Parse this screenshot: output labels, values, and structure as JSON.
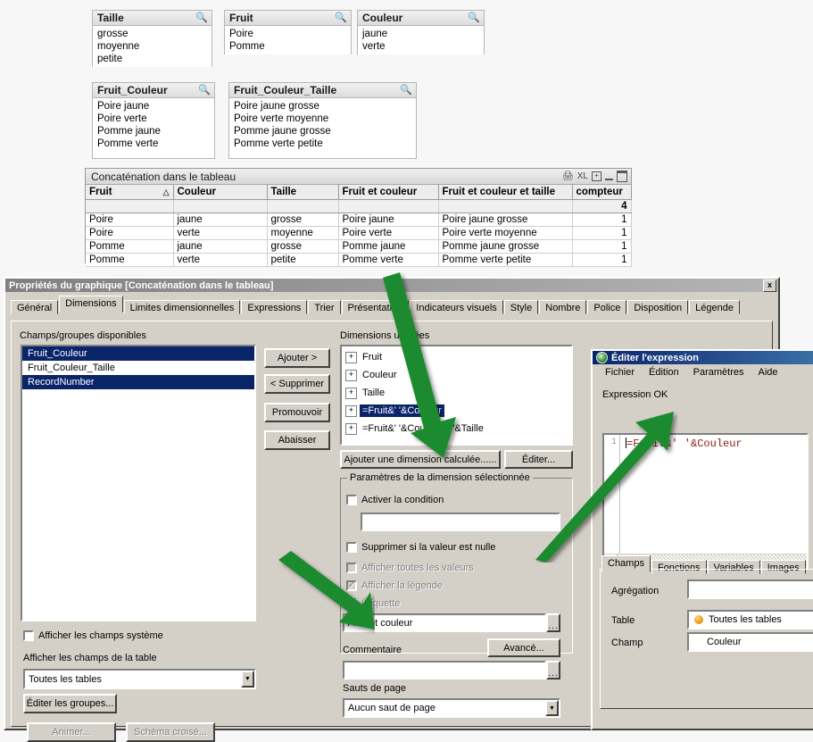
{
  "listboxes": [
    {
      "title": "Taille",
      "icon": "magnifier-icon",
      "values": [
        "grosse",
        "moyenne",
        "petite"
      ]
    },
    {
      "title": "Fruit",
      "icon": "magnifier-icon",
      "values": [
        "Poire",
        "Pomme"
      ]
    },
    {
      "title": "Couleur",
      "icon": "magnifier-icon",
      "values": [
        "jaune",
        "verte"
      ]
    },
    {
      "title": "Fruit_Couleur",
      "icon": "magnifier-icon",
      "values": [
        "Poire jaune",
        "Poire verte",
        "Pomme jaune",
        "Pomme verte"
      ]
    },
    {
      "title": "Fruit_Couleur_Taille",
      "icon": "magnifier-icon",
      "values": [
        "Poire jaune grosse",
        "Poire verte moyenne",
        "Pomme jaune grosse",
        "Pomme verte petite"
      ]
    }
  ],
  "chart": {
    "caption": "Concaténation dans le tableau",
    "icons": [
      "print-icon",
      "xl-export-icon",
      "expand-icon",
      "minimize-icon",
      "maximize-icon"
    ],
    "columns": [
      "Fruit",
      "Couleur",
      "Taille",
      "Fruit et couleur",
      "Fruit et couleur et taille",
      "compteur"
    ],
    "sorted_column": "Fruit",
    "total_row": [
      "",
      "",
      "",
      "",
      "",
      "4"
    ],
    "rows": [
      [
        "Poire",
        "jaune",
        "grosse",
        "Poire jaune",
        "Poire jaune grosse",
        "1"
      ],
      [
        "Poire",
        "verte",
        "moyenne",
        "Poire verte",
        "Poire verte moyenne",
        "1"
      ],
      [
        "Pomme",
        "jaune",
        "grosse",
        "Pomme jaune",
        "Pomme jaune grosse",
        "1"
      ],
      [
        "Pomme",
        "verte",
        "petite",
        "Pomme verte",
        "Pomme verte petite",
        "1"
      ]
    ]
  },
  "properties_dialog": {
    "title": "Propriétés du graphique [Concaténation dans le tableau]",
    "close_label": "x",
    "tabs": [
      {
        "label": "Général",
        "active": false
      },
      {
        "label": "Dimensions",
        "active": true
      },
      {
        "label": "Limites dimensionnelles",
        "active": false
      },
      {
        "label": "Expressions",
        "active": false
      },
      {
        "label": "Trier",
        "active": false
      },
      {
        "label": "Présentation",
        "active": false
      },
      {
        "label": "Indicateurs visuels",
        "active": false
      },
      {
        "label": "Style",
        "active": false
      },
      {
        "label": "Nombre",
        "active": false
      },
      {
        "label": "Police",
        "active": false
      },
      {
        "label": "Disposition",
        "active": false
      },
      {
        "label": "Légende",
        "active": false
      }
    ],
    "available_label": "Champs/groupes disponibles",
    "available_fields": [
      {
        "label": "Fruit_Couleur",
        "selected": true
      },
      {
        "label": "Fruit_Couleur_Taille",
        "selected": false
      },
      {
        "label": "RecordNumber",
        "selected": true
      }
    ],
    "transfer_buttons": [
      {
        "label": "Ajouter >",
        "disabled": false
      },
      {
        "label": "< Supprimer",
        "disabled": false
      },
      {
        "label": "Promouvoir",
        "disabled": false
      },
      {
        "label": "Abaisser",
        "disabled": false
      }
    ],
    "used_label": "Dimensions utilisées",
    "used_dimensions": [
      {
        "label": "Fruit",
        "selected": false
      },
      {
        "label": "Couleur",
        "selected": false
      },
      {
        "label": "Taille",
        "selected": false
      },
      {
        "label": "=Fruit&' '&Couleur",
        "selected": true
      },
      {
        "label": "=Fruit&' '&Couleur&' '&Taille",
        "selected": false
      }
    ],
    "add_calculated_label": "Ajouter une dimension calculée......",
    "edit_label": "Éditer...",
    "settings_group_title": "Paramètres de la dimension sélectionnée",
    "enable_condition_label": "Activer la condition",
    "enable_condition_checked": false,
    "condition_value": "",
    "suppress_null_label": "Supprimer si la valeur est nulle",
    "suppress_null_checked": false,
    "show_all_values_label": "Afficher toutes les valeurs",
    "show_all_values_checked": false,
    "show_legend_label": "Afficher la légende",
    "show_legend_checked": true,
    "label_label": "Étiquette",
    "label_checked": true,
    "label_value": "Fruit et couleur",
    "advanced_label": "Avancé...",
    "comment_label": "Commentaire",
    "comment_value": "",
    "pagebreak_label": "Sauts de page",
    "pagebreak_value": "Aucun saut de page",
    "show_system_fields_label": "Afficher les champs système",
    "show_system_fields_checked": false,
    "show_table_fields_label": "Afficher les champs de la table",
    "table_filter_value": "Toutes les tables",
    "edit_groups_label": "Éditer les groupes...",
    "animate_label": "Animer...",
    "crosstable_label": "Schéma croisé...",
    "ellipsis": "..."
  },
  "expression_editor": {
    "title": "Éditer l'expression",
    "window_icon": "qlikview-app-icon",
    "menu": [
      "Fichier",
      "Édition",
      "Paramètres",
      "Aide"
    ],
    "status": "Expression OK",
    "line_number": "1",
    "expression": "=Fruit&' '&Couleur",
    "tabs": [
      {
        "label": "Champs",
        "active": true
      },
      {
        "label": "Fonctions",
        "active": false
      },
      {
        "label": "Variables",
        "active": false
      },
      {
        "label": "Images",
        "active": false
      }
    ],
    "aggregation_label": "Agrégation",
    "aggregation_value": "",
    "table_label": "Table",
    "table_value": "Toutes les tables",
    "field_label": "Champ",
    "field_value": "Couleur"
  },
  "annotations": {
    "arrow_color": "#1f8a2e",
    "arrows": [
      "arrow-to-add-calculated-dimension",
      "arrow-to-label-field",
      "arrow-to-expression-text"
    ]
  }
}
